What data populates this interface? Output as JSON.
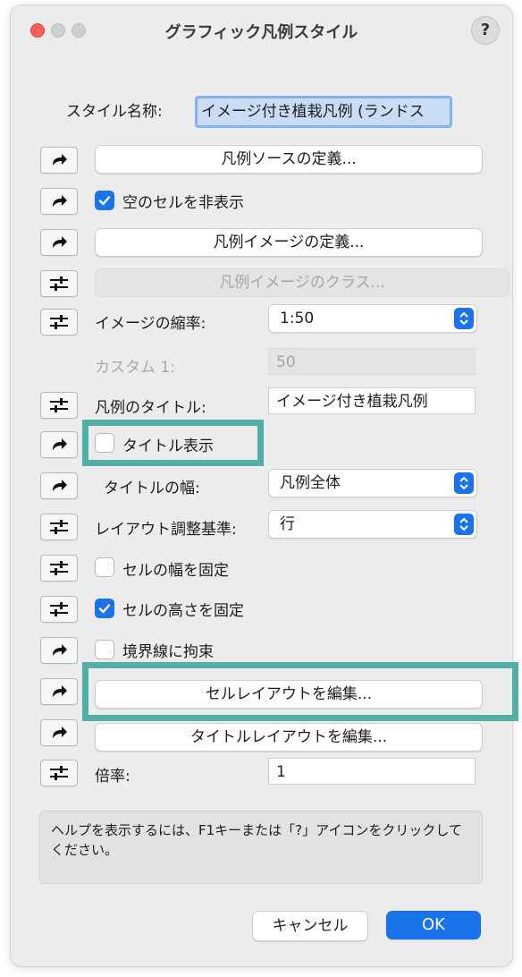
{
  "window": {
    "title": "グラフィック凡例スタイル",
    "help_label": "?"
  },
  "style_name": {
    "label": "スタイル名称:",
    "value": "イメージ付き植栽凡例 (ランドス"
  },
  "rows": {
    "legend_source": {
      "button": "凡例ソースの定義..."
    },
    "hide_empty": {
      "label": "空のセルを非表示",
      "checked": true
    },
    "legend_image": {
      "button": "凡例イメージの定義..."
    },
    "legend_image_class": {
      "button": "凡例イメージのクラス..."
    },
    "image_scale": {
      "label": "イメージの縮率:",
      "value": "1:50"
    },
    "custom": {
      "label": "カスタム 1:",
      "value": "50"
    },
    "legend_title": {
      "label": "凡例のタイトル:",
      "value": "イメージ付き植栽凡例"
    },
    "show_title": {
      "label": "タイトル表示",
      "checked": false
    },
    "title_width": {
      "label": "タイトルの幅:",
      "value": "凡例全体"
    },
    "layout_basis": {
      "label": "レイアウト調整基準:",
      "value": "行"
    },
    "fix_cell_width": {
      "label": "セルの幅を固定",
      "checked": false
    },
    "fix_cell_height": {
      "label": "セルの高さを固定",
      "checked": true
    },
    "constrain_border": {
      "label": "境界線に拘束",
      "checked": false
    },
    "edit_cell_layout": {
      "button": "セルレイアウトを編集..."
    },
    "edit_title_layout": {
      "button": "タイトルレイアウトを編集..."
    },
    "magnification": {
      "label": "倍率:",
      "value": "1"
    }
  },
  "help_text": "ヘルプを表示するには、F1キーまたは「?」アイコンをクリックしてください。",
  "footer": {
    "cancel_label": "キャンセル",
    "ok_label": "OK"
  },
  "colors": {
    "accent": "#1a73e8",
    "highlight": "#52aea6"
  }
}
